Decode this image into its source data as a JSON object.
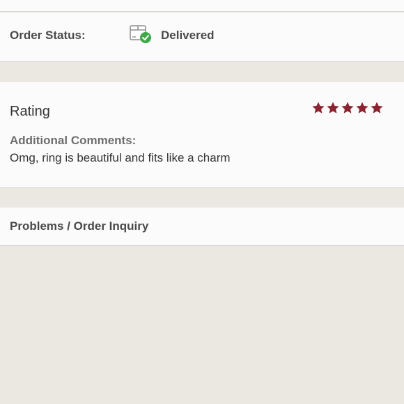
{
  "order_status": {
    "label": "Order Status:",
    "icon": "package-delivered-icon",
    "value": "Delivered",
    "check_color": "#3fa94a"
  },
  "rating": {
    "title": "Rating",
    "stars": 5,
    "max_stars": 5,
    "star_color": "#8b2330",
    "comments_label": "Additional Comments:",
    "comments_text": "Omg, ring is beautiful and fits like a charm"
  },
  "problems": {
    "label": "Problems / Order Inquiry"
  }
}
